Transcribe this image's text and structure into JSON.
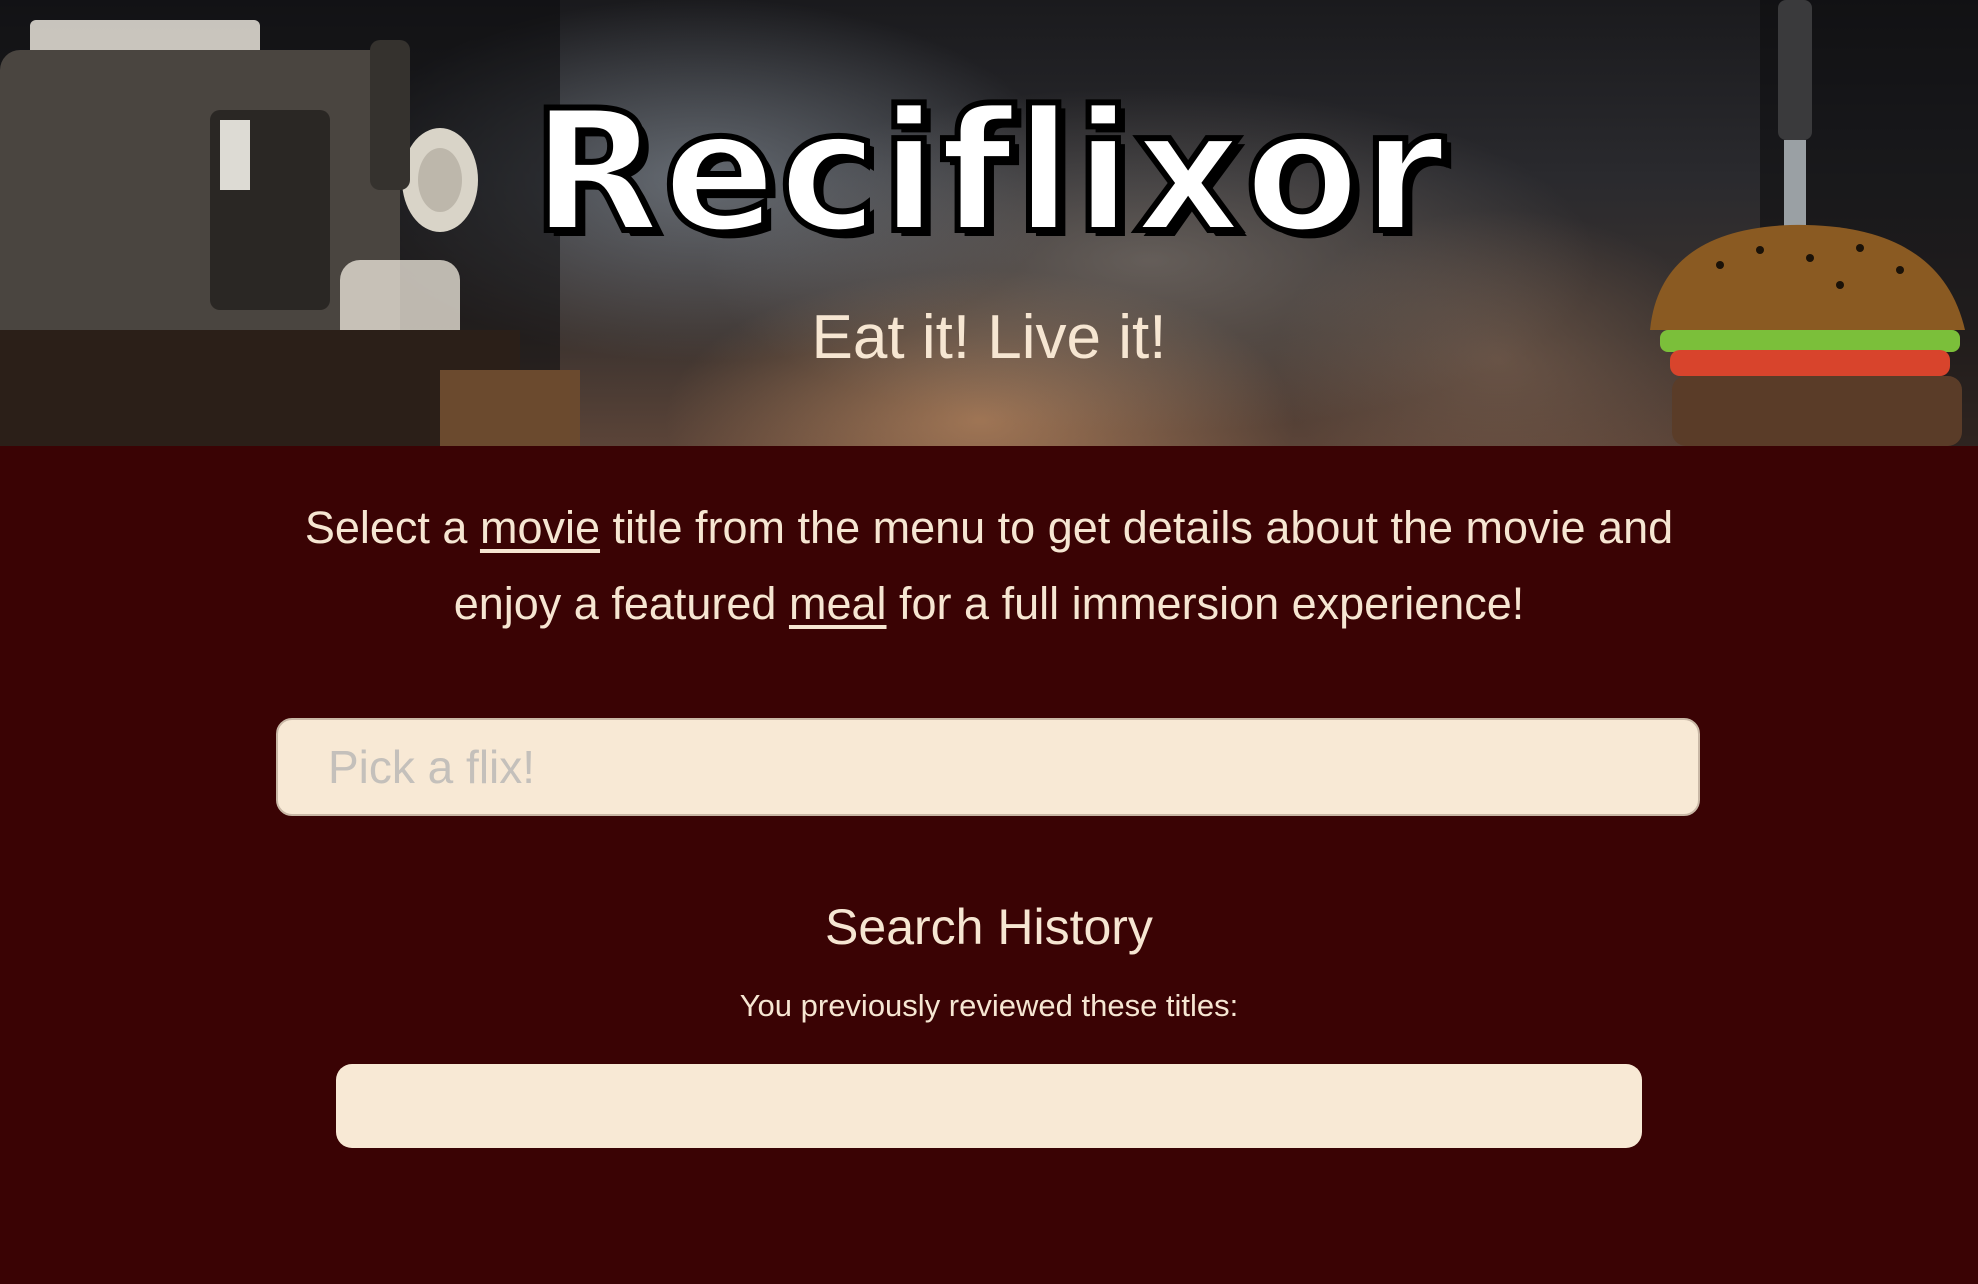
{
  "header": {
    "brand": "Reciflixor",
    "tagline": "Eat it! Live it!"
  },
  "intro": {
    "part1": "Select a ",
    "link_movie": "movie",
    "part2": " title from the menu to get details about the movie and",
    "part3": "enjoy a featured ",
    "link_meal": "meal",
    "part4": " for a full immersion experience!"
  },
  "search": {
    "placeholder": "Pick a flix!",
    "value": ""
  },
  "history": {
    "title": "Search History",
    "subtitle": "You previously reviewed these titles:",
    "items": []
  },
  "colors": {
    "background": "#3a0304",
    "text": "#f6e6d2",
    "field": "#f8e9d5"
  }
}
